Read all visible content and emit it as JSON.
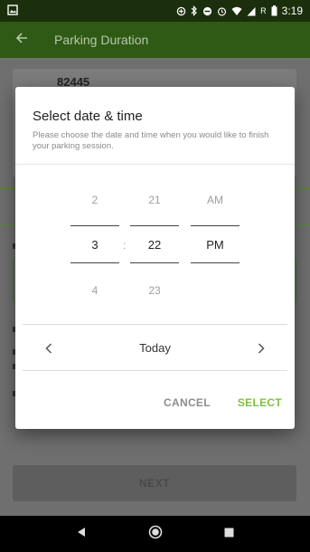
{
  "status_bar": {
    "time": "3:19",
    "network_letter": "R"
  },
  "app_bar": {
    "title": "Parking Duration"
  },
  "background": {
    "code": "82445",
    "next_label": "NEXT"
  },
  "dialog": {
    "title": "Select date & time",
    "description": "Please choose the date and time when you would like to finish your parking session.",
    "picker": {
      "hour": {
        "prev": "2",
        "selected": "3",
        "next": "4"
      },
      "separator": ":",
      "minute": {
        "prev": "21",
        "selected": "22",
        "next": "23"
      },
      "ampm": {
        "prev": "AM",
        "selected": "PM"
      }
    },
    "day_label": "Today",
    "cancel_label": "CANCEL",
    "select_label": "SELECT"
  },
  "colors": {
    "accent": "#7ec142",
    "app_bar": "#2f5a15",
    "status_bar": "#1b2f0d"
  }
}
